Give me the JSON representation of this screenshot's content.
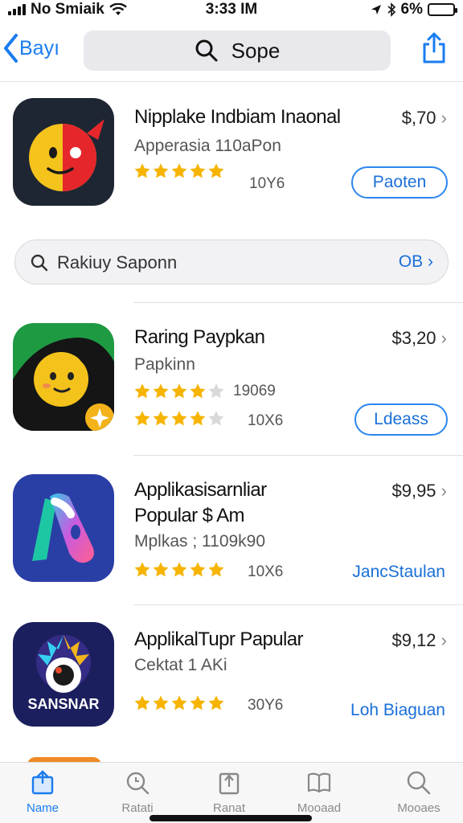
{
  "status_bar": {
    "carrier": "No Smiaik",
    "time": "3:33 IM",
    "battery": "6%"
  },
  "nav": {
    "back_label": "Bayı",
    "search_text": "Sope"
  },
  "apps": [
    {
      "title": "Nipplake Indbiam Inaonal",
      "subtitle": "Apperasia 110aPon",
      "price": "$,70",
      "rating_text": "10Y6",
      "button": "Paoten",
      "stars": 5
    },
    {
      "title": "Raring Paypkan",
      "subtitle": "Papkinn",
      "price": "$3,20",
      "rating_count": "19069",
      "rating_text": "10X6",
      "button": "Ldeass",
      "stars": 4
    },
    {
      "title": "Applikasisarnliar",
      "title2": "Popular $ Am",
      "subtitle": "Mplkas ; 1109k90",
      "price": "$9,95",
      "rating_text": "10X6",
      "button": "JancStaulan",
      "stars": 5
    },
    {
      "title": "ApplikalTupr Papular",
      "subtitle": "Cektat 1 AKi",
      "price": "$9,12",
      "rating_text": "30Y6",
      "button": "Loh Biaguan",
      "stars": 5
    }
  ],
  "inline_search": {
    "label": "Rakiuy Saponn",
    "right": "OB"
  },
  "icon_label": "SANSNAR",
  "tabs": [
    {
      "label": "Name",
      "icon": "today-icon"
    },
    {
      "label": "Ratati",
      "icon": "search-zoom-icon"
    },
    {
      "label": "Ranat",
      "icon": "apps-stack-icon"
    },
    {
      "label": "Mooaad",
      "icon": "book-icon"
    },
    {
      "label": "Mooaes",
      "icon": "search-icon"
    }
  ],
  "colors": {
    "accent": "#1a7cf0",
    "star": "#f6b400",
    "star_empty": "#d9d9d9"
  }
}
